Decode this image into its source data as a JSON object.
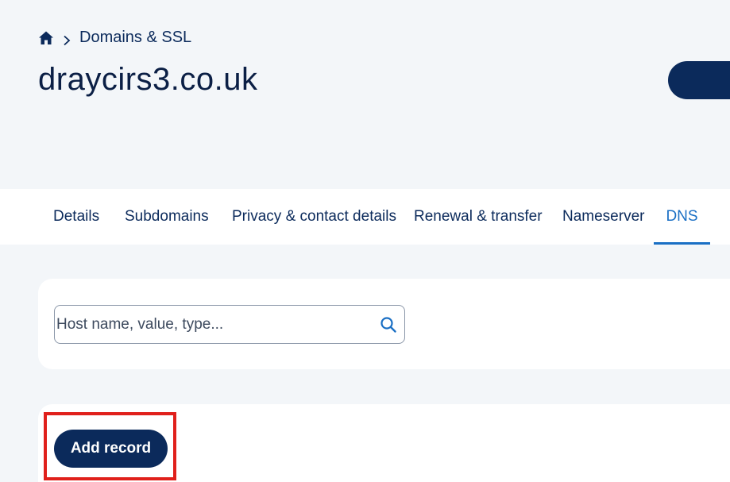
{
  "breadcrumb": {
    "home_icon": "home-icon",
    "separator_icon": "chevron-right-icon",
    "label": "Domains & SSL"
  },
  "page": {
    "title": "draycirs3.co.uk"
  },
  "tabs": [
    {
      "label": "Details",
      "active": false
    },
    {
      "label": "Subdomains",
      "active": false
    },
    {
      "label": "Privacy & contact details",
      "active": false
    },
    {
      "label": "Renewal & transfer",
      "active": false
    },
    {
      "label": "Nameserver",
      "active": false
    },
    {
      "label": "DNS",
      "active": true
    }
  ],
  "search": {
    "placeholder": "Host name, value, type...",
    "value": "",
    "icon": "search-icon"
  },
  "records": {
    "add_label": "Add record"
  },
  "colors": {
    "brand_navy": "#0b2a5b",
    "accent_blue": "#1a6fc4",
    "page_bg": "#f3f6f9",
    "highlight_red": "#e0201b"
  }
}
